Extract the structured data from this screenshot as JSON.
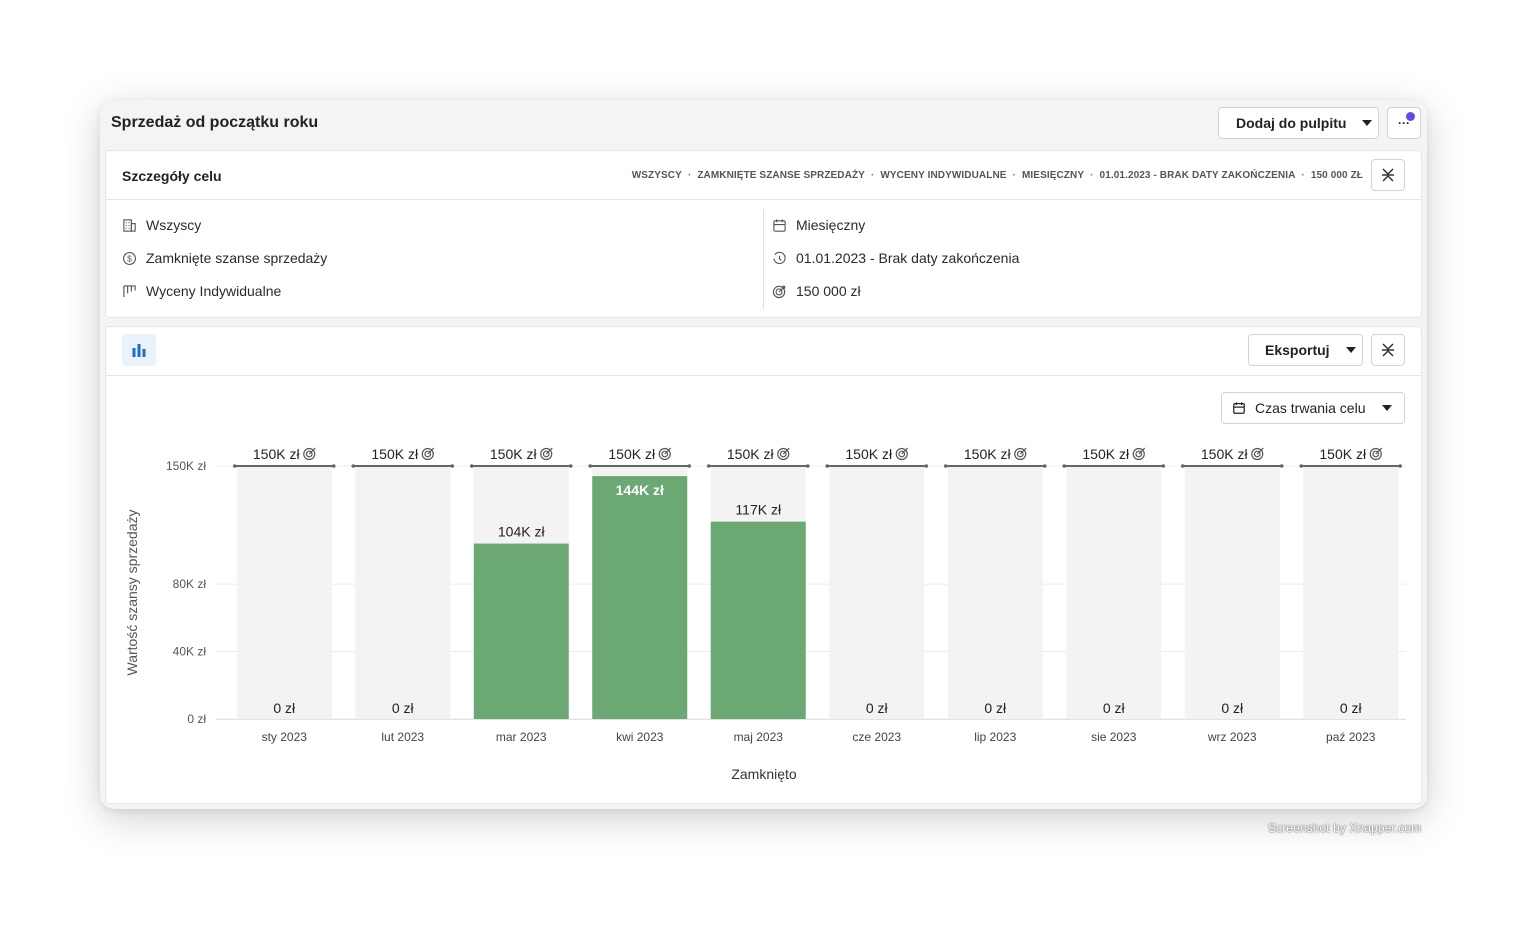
{
  "page": {
    "title": "Sprzedaż od początku roku",
    "add_dashboard_label": "Dodaj do pulpitu",
    "more_label": "···"
  },
  "details": {
    "title": "Szczegóły celu",
    "summary": [
      "WSZYSCY",
      "ZAMKNIĘTE SZANSE SPRZEDAŻY",
      "WYCENY INDYWIDUALNE",
      "MIESIĘCZNY",
      "01.01.2023 - BRAK DATY ZAKOŃCZENIA",
      "150 000 ZŁ"
    ],
    "left": [
      {
        "icon": "building-icon",
        "label": "Wszyscy"
      },
      {
        "icon": "dollar-circle-icon",
        "label": "Zamknięte szanse sprzedaży"
      },
      {
        "icon": "pipeline-icon",
        "label": "Wyceny Indywidualne"
      }
    ],
    "right": [
      {
        "icon": "calendar-icon",
        "label": "Miesięczny"
      },
      {
        "icon": "history-icon",
        "label": "01.01.2023 - Brak daty zakończenia"
      },
      {
        "icon": "target-icon",
        "label": "150 000 zł"
      }
    ]
  },
  "chart_panel": {
    "export_label": "Eksportuj",
    "period_label": "Czas trwania celu"
  },
  "colors": {
    "bar": "#6ca874",
    "bar_bg": "#f3f3f3",
    "accent": "#1f6fc5"
  },
  "chart_data": {
    "type": "bar",
    "xlabel": "Zamknięto",
    "ylabel": "Wartość szansy sprzedaży",
    "ylim": [
      0,
      150000
    ],
    "yticks": [
      {
        "value": 0,
        "label": "0 zł"
      },
      {
        "value": 40000,
        "label": "40K zł"
      },
      {
        "value": 80000,
        "label": "80K zł"
      },
      {
        "value": 150000,
        "label": "150K zł"
      }
    ],
    "goal_value": 150000,
    "goal_label": "150K zł",
    "categories": [
      "sty 2023",
      "lut 2023",
      "mar 2023",
      "kwi 2023",
      "maj 2023",
      "cze 2023",
      "lip 2023",
      "sie 2023",
      "wrz 2023",
      "paź 2023"
    ],
    "values": [
      0,
      0,
      104000,
      144000,
      117000,
      0,
      0,
      0,
      0,
      0
    ],
    "value_labels": [
      "0 zł",
      "0 zł",
      "104K zł",
      "144K zł",
      "117K zł",
      "0 zł",
      "0 zł",
      "0 zł",
      "0 zł",
      "0 zł"
    ],
    "grid": true,
    "legend": "none"
  },
  "watermark": "Screenshot by Xnapper.com"
}
